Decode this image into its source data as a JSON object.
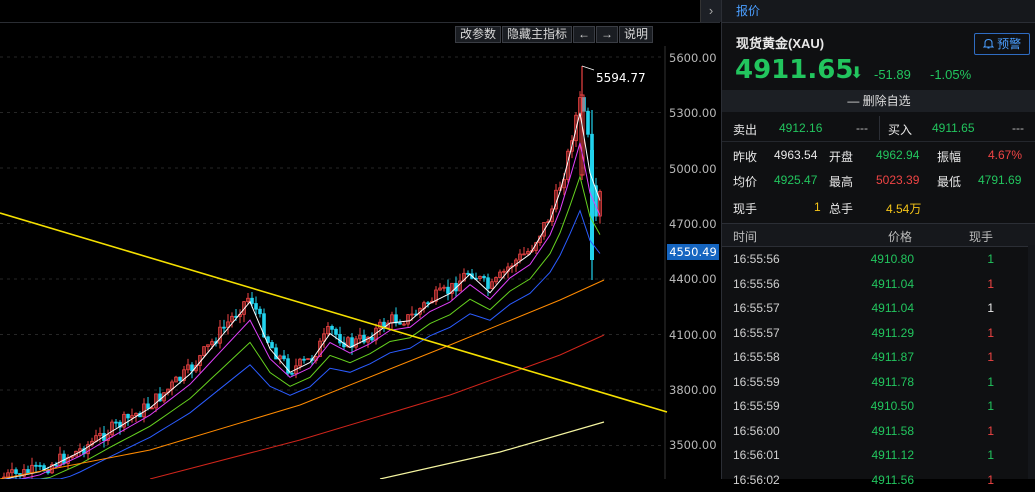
{
  "chart": {
    "toolbar": {
      "params_label": "改参数",
      "hide_indicator_label": "隐藏主指标",
      "prev_label": "←",
      "next_label": "→",
      "help_label": "说明"
    },
    "collapse_label": "›",
    "y_axis_labels": [
      "5600.00",
      "5300.00",
      "5000.00",
      "4700.00",
      "4400.00",
      "4100.00",
      "3800.00",
      "3500.00"
    ],
    "current_price_tag": "4550.49",
    "peak_label": "5594.77",
    "colors": {
      "up": "#ef4444",
      "down": "#22d3ee",
      "trendline": "#f5e000",
      "ma5": "#ffffff",
      "ma10": "#e040fb",
      "ma20": "#66d21f",
      "ma30": "#2b5cff",
      "ma60": "#ff8a00",
      "ma120": "#d0251b",
      "ma250": "#f5f5a0"
    }
  },
  "panel": {
    "tab_label": "报价",
    "symbol_name": "现货黄金(XAU)",
    "alert_label": "预警",
    "alert_icon": "bell-icon",
    "last_price": "4911.65",
    "arrow": "⬇",
    "change": "-51.89",
    "change_pct": "-1.05%",
    "remove_fav_label": "删除自选",
    "sell_label": "卖出",
    "sell_price": "4912.16",
    "sell_vol": "---",
    "buy_label": "买入",
    "buy_price": "4911.65",
    "buy_vol": "---",
    "prev_close_label": "昨收",
    "prev_close": "4963.54",
    "open_label": "开盘",
    "open": "4962.94",
    "amplitude_label": "振幅",
    "amplitude": "4.67%",
    "avg_label": "均价",
    "avg": "4925.47",
    "high_label": "最高",
    "high": "5023.39",
    "low_label": "最低",
    "low": "4791.69",
    "cur_vol_label": "现手",
    "cur_vol": "1",
    "total_vol_label": "总手",
    "total_vol": "4.54万",
    "ticks_header": {
      "time": "时间",
      "price": "价格",
      "vol": "现手"
    },
    "ticks": [
      {
        "time": "16:55:56",
        "price": "4910.80",
        "vol": "1",
        "dir": "g"
      },
      {
        "time": "16:55:56",
        "price": "4911.04",
        "vol": "1",
        "dir": "r"
      },
      {
        "time": "16:55:57",
        "price": "4911.04",
        "vol": "1",
        "dir": "w"
      },
      {
        "time": "16:55:57",
        "price": "4911.29",
        "vol": "1",
        "dir": "r"
      },
      {
        "time": "16:55:58",
        "price": "4911.87",
        "vol": "1",
        "dir": "r"
      },
      {
        "time": "16:55:59",
        "price": "4911.78",
        "vol": "1",
        "dir": "g"
      },
      {
        "time": "16:55:59",
        "price": "4910.50",
        "vol": "1",
        "dir": "g"
      },
      {
        "time": "16:56:00",
        "price": "4911.58",
        "vol": "1",
        "dir": "r"
      },
      {
        "time": "16:56:01",
        "price": "4911.12",
        "vol": "1",
        "dir": "g"
      },
      {
        "time": "16:56:02",
        "price": "4911.56",
        "vol": "1",
        "dir": "r"
      }
    ]
  }
}
